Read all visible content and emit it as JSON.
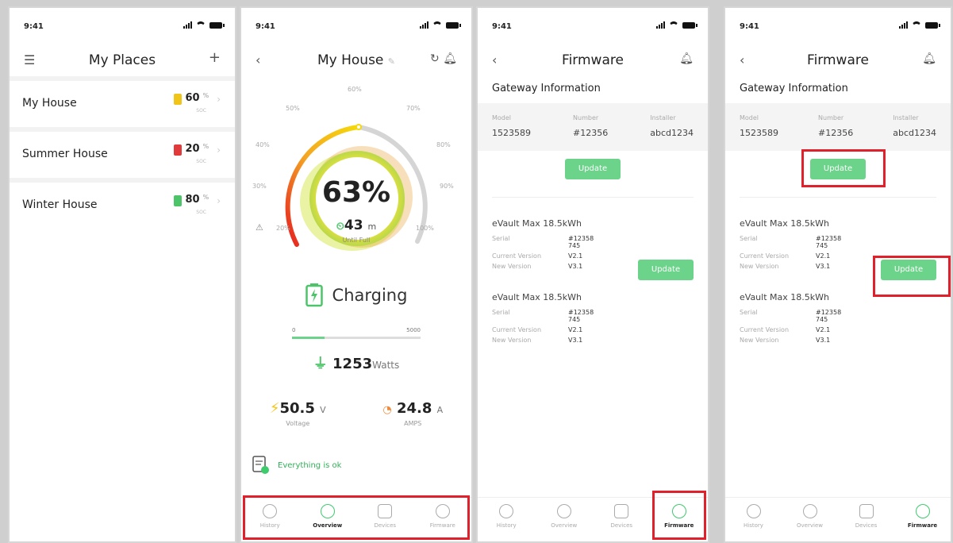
{
  "status_time": "9:41",
  "screen1": {
    "title": "My Places",
    "places": [
      {
        "name": "My House",
        "soc": "60",
        "color": "#f0c419"
      },
      {
        "name": "Summer House",
        "soc": "20",
        "color": "#e03a3a"
      },
      {
        "name": "Winter House",
        "soc": "80",
        "color": "#4ec46a"
      }
    ],
    "soc_unit": "%",
    "soc_label": "SOC"
  },
  "screen2": {
    "title": "My House",
    "soc_pct": "63%",
    "time_value": "43",
    "time_unit": "m",
    "until_full": "Until Full",
    "ticks": [
      "20%",
      "30%",
      "40%",
      "50%",
      "60%",
      "70%",
      "80%",
      "90%",
      "100%"
    ],
    "status": "Charging",
    "range_min": "0",
    "range_max": "5000",
    "range_fill_fraction": 0.25,
    "watts_value": "1253",
    "watts_unit": "Watts",
    "voltage_value": "50.5",
    "voltage_unit": "V",
    "voltage_label": "Voltage",
    "amps_value": "24.8",
    "amps_unit": "A",
    "amps_label": "AMPS",
    "ok_message": "Everything is ok"
  },
  "tabs": [
    "History",
    "Overview",
    "Devices",
    "Firmware"
  ],
  "firmware": {
    "title": "Firmware",
    "gateway_heading": "Gateway Information",
    "gw_keys": [
      "Model",
      "Number",
      "Installer"
    ],
    "gw_vals": [
      "1523589",
      "#12356",
      "abcd1234"
    ],
    "update_label": "Update",
    "device_name": "eVault Max 18.5kWh",
    "k_serial": "Serial",
    "serial_1": "#12358",
    "serial_2": "745",
    "k_current": "Current Version",
    "v_current": "V2.1",
    "k_new": "New Version",
    "v_new": "V3.1"
  },
  "colors": {
    "accent": "#6cd48a",
    "highlight": "#e0202a"
  }
}
